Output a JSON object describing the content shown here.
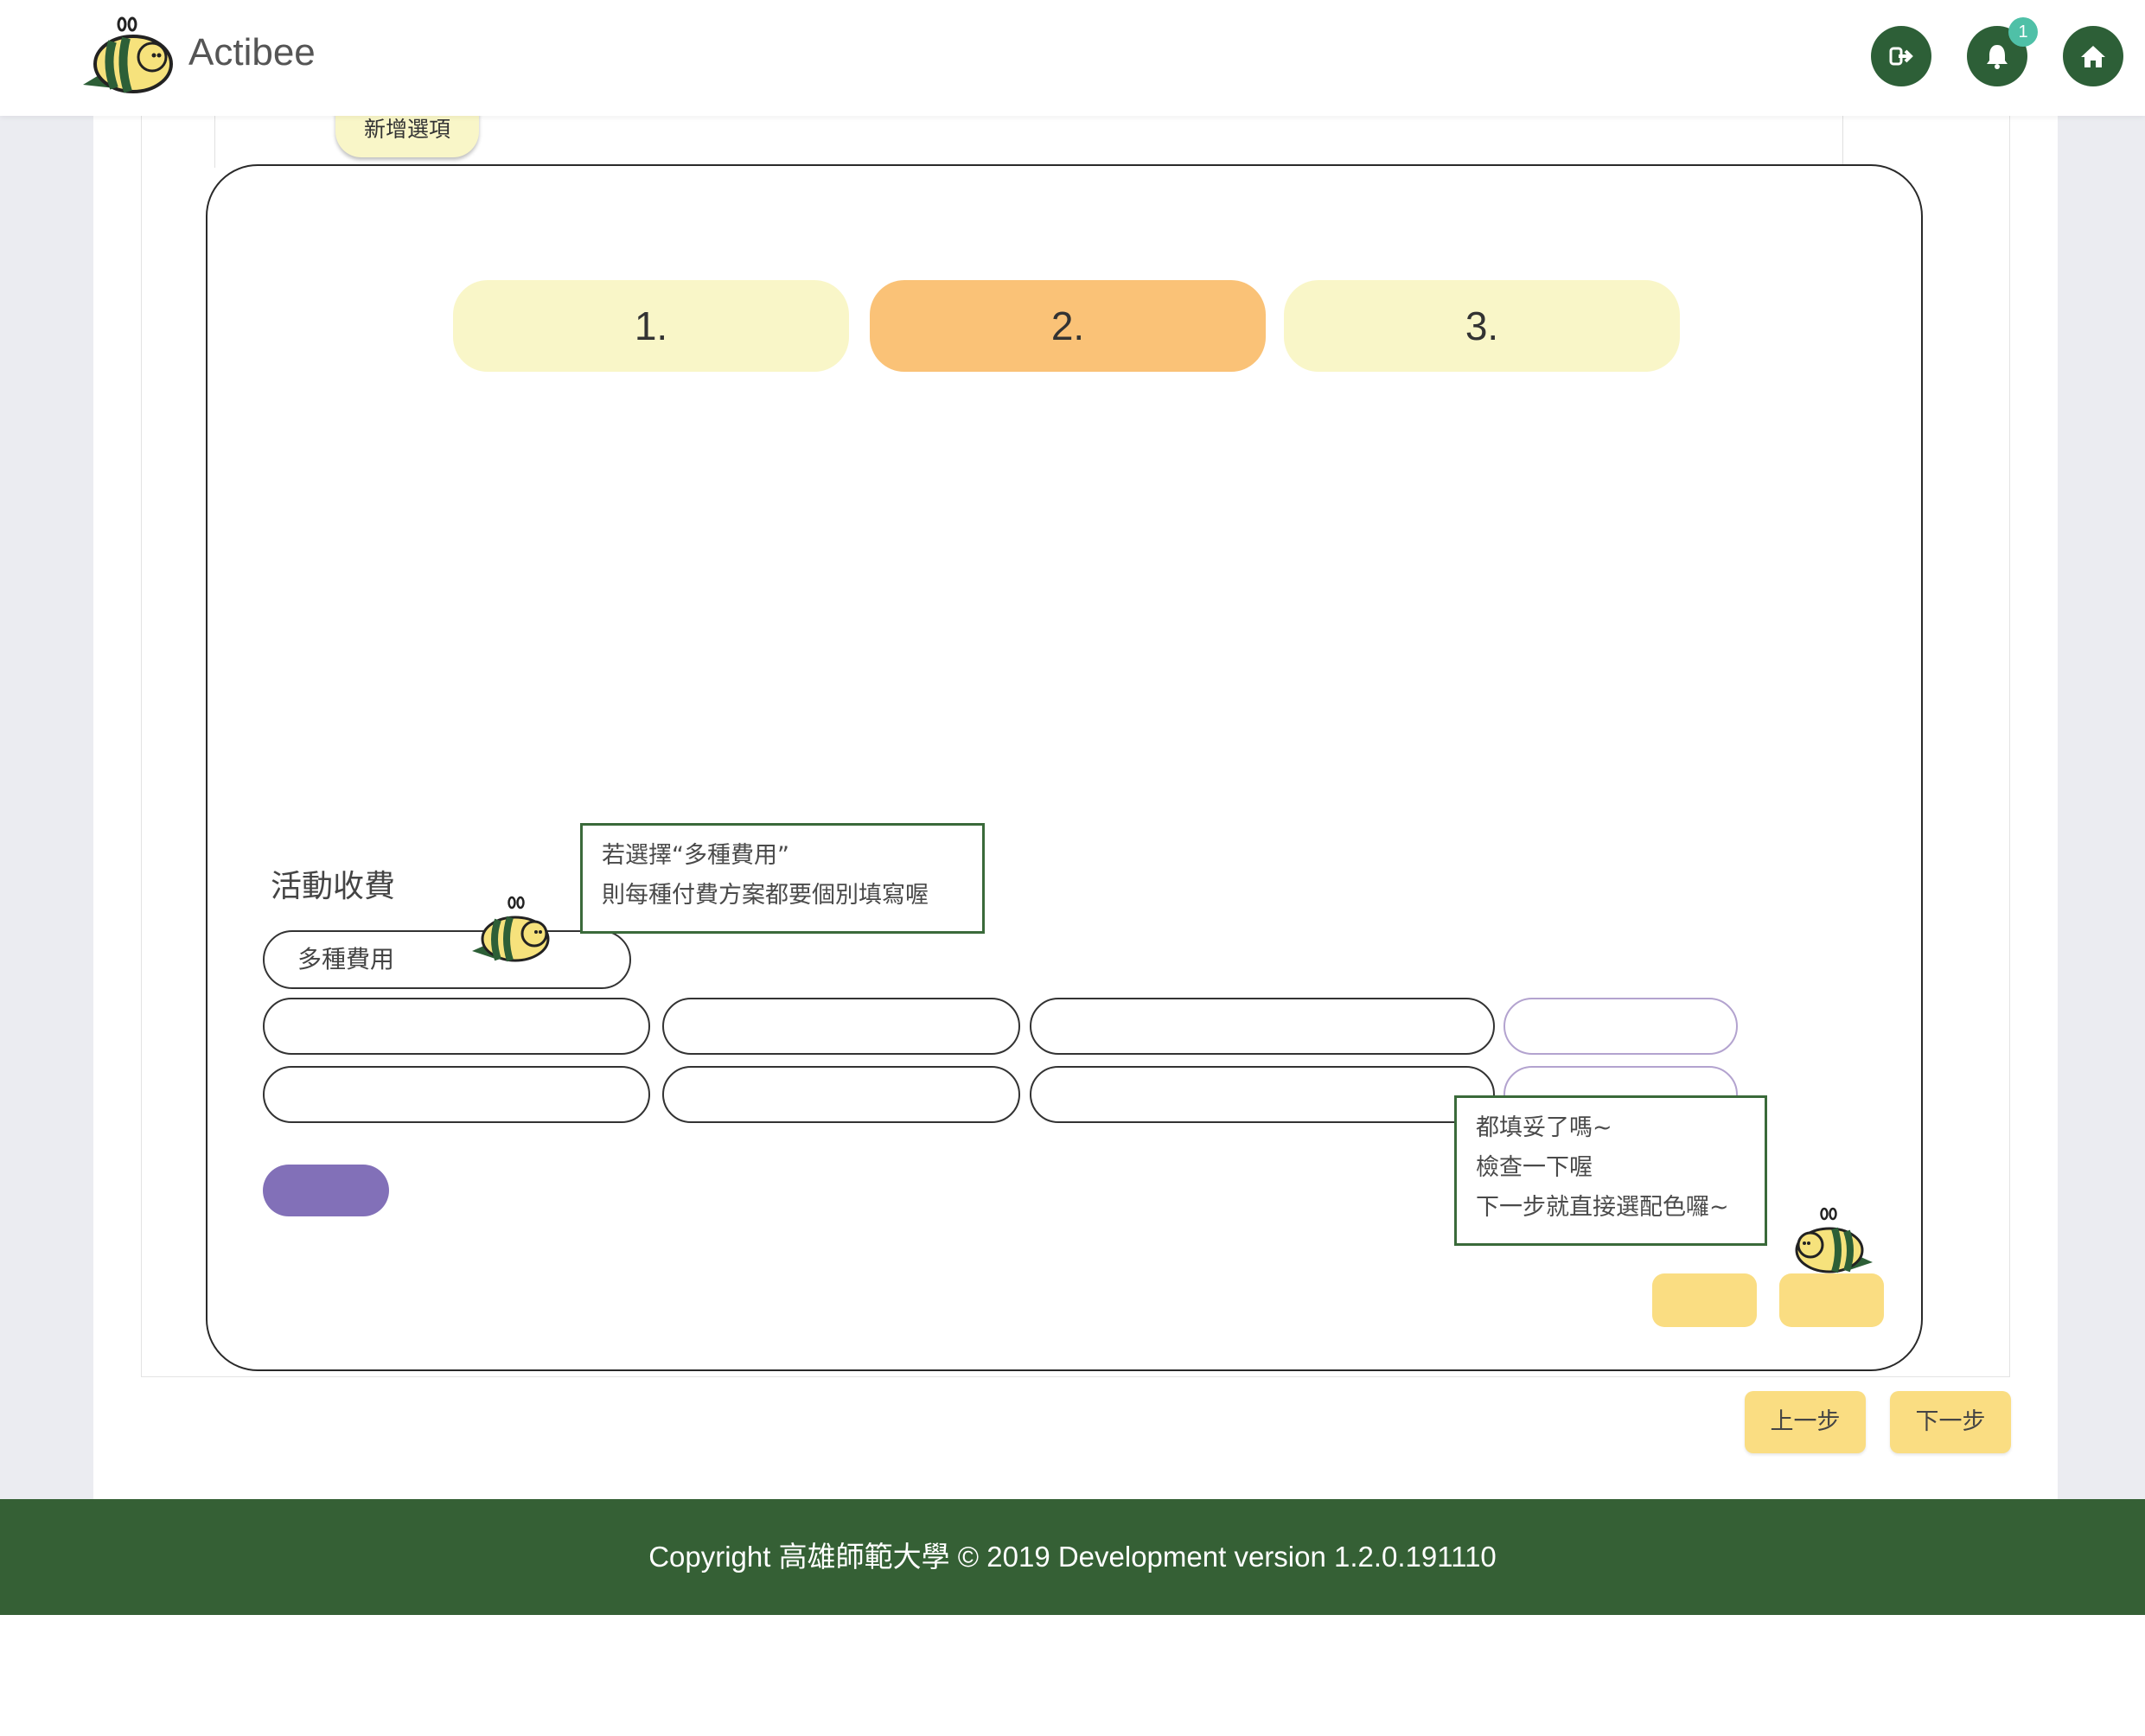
{
  "header": {
    "brand": "Actibee",
    "notification_count": "1",
    "icons": [
      "logout-icon",
      "bell-icon",
      "home-icon"
    ]
  },
  "form": {
    "add_option_label": "新增選項",
    "steps": [
      "1.",
      "2.",
      "3."
    ],
    "active_step": 2,
    "fee_label": "活動收費",
    "fee_select_value": "多種費用"
  },
  "tips": {
    "fee_tip": [
      "若選擇“多種費用”",
      "則每種付費方案都要個別填寫喔"
    ],
    "check_tip": [
      "都填妥了嗎~",
      "檢查一下喔",
      "下一步就直接選配色囉~"
    ]
  },
  "nav": {
    "prev_label": "上一步",
    "next_label": "下一步"
  },
  "footer": {
    "copyright": "Copyright 高雄師範大學 © 2019 Development version 1.2.0.191110"
  },
  "colors": {
    "brand_green": "#2d5f37",
    "footer_green": "#356035",
    "step_pale": "#f9f6c8",
    "step_active": "#fac277",
    "button_yellow": "#fadd82",
    "accent_purple": "#8270b8",
    "badge_teal": "#4fc0a7"
  }
}
